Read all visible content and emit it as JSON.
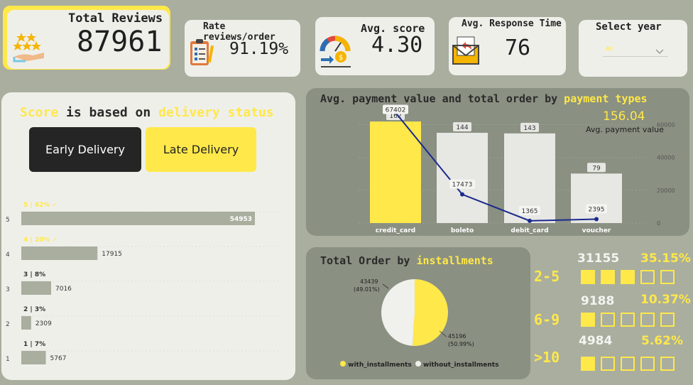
{
  "kpis": {
    "total_reviews": {
      "title": "Total Reviews",
      "value": "87961"
    },
    "rate_reviews": {
      "title": "Rate reviews/order",
      "value": "91.19%"
    },
    "avg_score": {
      "title": "Avg. score",
      "value": "4.30"
    },
    "avg_response": {
      "title": "Avg. Response Time",
      "value": "76"
    },
    "select_year": {
      "title": "Select year",
      "value": "All"
    }
  },
  "score_panel": {
    "title_part1": "Score",
    "title_part2": " is based on ",
    "title_part3": "delivery status",
    "early_button": "Early Delivery",
    "late_button": "Late Delivery"
  },
  "payment_panel": {
    "title_part1": "Avg. payment value and total order by ",
    "title_part2": "payment types",
    "avg_value": "156.04",
    "avg_label": "Avg. payment value"
  },
  "installments_panel": {
    "title_part1": "Total Order by ",
    "title_part2": "installments",
    "legend": [
      "with_installments",
      "without_installments"
    ],
    "groups": [
      {
        "label": "2-5",
        "count": "31155",
        "pct": "35.15%",
        "filled": 3
      },
      {
        "label": "6-9",
        "count": "9188",
        "pct": "10.37%",
        "filled": 1
      },
      {
        "label": ">10",
        "count": "4984",
        "pct": "5.62%",
        "filled": 1
      }
    ]
  },
  "colors": {
    "accent": "#ffe84a",
    "bar_grey": "#e7e7e4",
    "line": "#1a2a8c",
    "score_bar": "#a9ae9f"
  },
  "chart_data": [
    {
      "type": "bar",
      "title": "",
      "categories": [
        "5",
        "4",
        "3",
        "2",
        "1"
      ],
      "values": [
        54953,
        17915,
        7016,
        2309,
        5767
      ],
      "data_labels": [
        "5 | 62% ✓",
        "4 | 20% ✓",
        "3 | 8%",
        "2 | 3%",
        "1 | 7%"
      ],
      "orientation": "horizontal"
    },
    {
      "type": "bar",
      "categories": [
        "credit_card",
        "boleto",
        "debit_card",
        "voucher"
      ],
      "series": [
        {
          "name": "",
          "type": "bar",
          "values": [
            162,
            144,
            143,
            79
          ]
        },
        {
          "name": "",
          "type": "line",
          "values": [
            67402,
            17473,
            1365,
            2395
          ]
        }
      ],
      "y2_ticks": [
        0,
        20000,
        40000,
        60000
      ],
      "ylim2": [
        0,
        70000
      ]
    },
    {
      "type": "pie",
      "categories": [
        "with_installments",
        "without_installments"
      ],
      "values": [
        45196,
        43439
      ],
      "data_labels": [
        "45196\n(50.99%)",
        "43439\n(49.01%)"
      ]
    }
  ]
}
